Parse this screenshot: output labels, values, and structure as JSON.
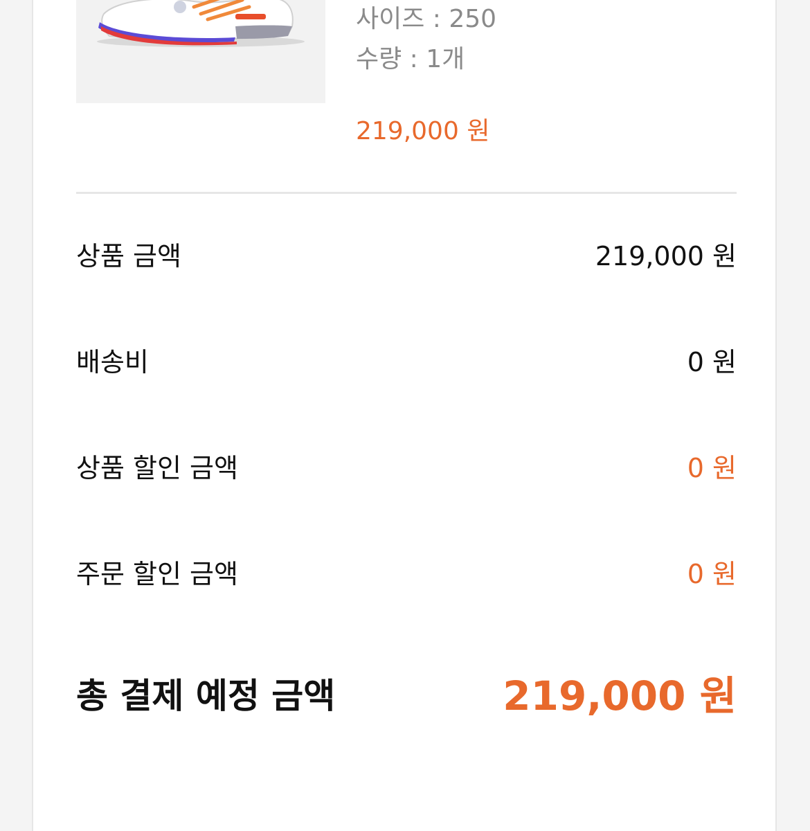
{
  "product": {
    "image": "sneaker-image",
    "options": [
      "사이즈 : 250",
      "수량 : 1개"
    ],
    "price": "219,000 원"
  },
  "summary": [
    {
      "label": "상품 금액",
      "value": "219,000 원",
      "accent": false
    },
    {
      "label": "배송비",
      "value": "0 원",
      "accent": false
    },
    {
      "label": "상품 할인 금액",
      "value": "0 원",
      "accent": true
    },
    {
      "label": "주문 할인 금액",
      "value": "0 원",
      "accent": true
    }
  ],
  "total": {
    "label": "총 결제 예정 금액",
    "value": "219,000 원"
  },
  "colors": {
    "accent": "#e8692c",
    "text": "#111111",
    "muted": "#8a8a8a",
    "divider": "#e6e6e6"
  }
}
